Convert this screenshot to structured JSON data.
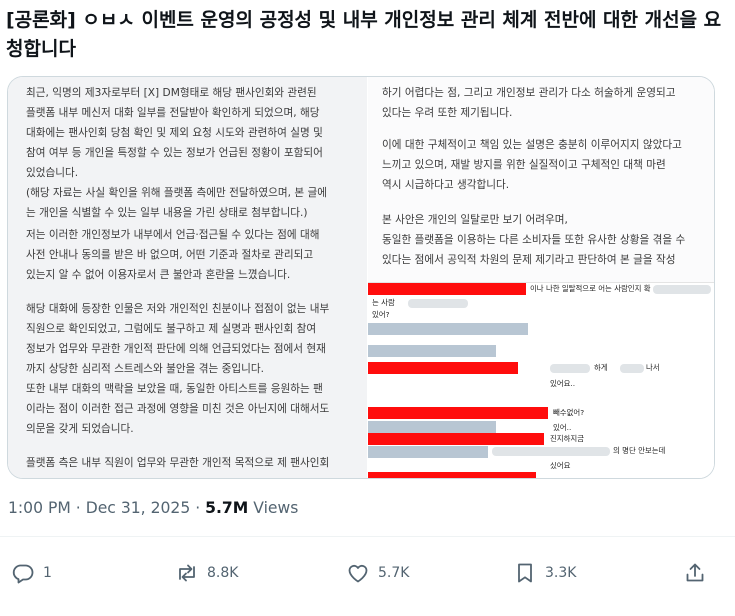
{
  "tweet": {
    "title": "[공론화] ㅇㅂㅅ 이벤트 운영의 공정성 및 내부 개인정보 관리 체계 전반에 대한 개선을 요청합니다",
    "time": "1:00 PM · Dec 31, 2025 · ",
    "views_count": "5.7M",
    "views_label": " Views"
  },
  "image": {
    "left_paragraphs": [
      "최근, 익명의 제3자로부터 [X] DM형태로 해당 팬사인회와 관련된\n플랫폼 내부 메신저 대화 일부를 전달받아 확인하게 되었으며, 해당\n대화에는 팬사인회 당첨 확인 및 제외 요청 시도와 관련하여 실명 및\n참여 여부 등 개인을 특정할 수 있는 정보가 언급된 정황이 포함되어\n있었습니다.\n(해당 자료는 사실 확인을 위해 플랫폼 측에만 전달하였으며, 본 글에\n는 개인을 식별할 수 있는 일부 내용을 가린 상태로 첨부합니다.)",
      "저는 이러한 개인정보가 내부에서 언급·접근될 수 있다는 점에 대해\n사전 안내나 동의를 받은 바 없으며, 어떤 기준과 절차로 관리되고\n있는지 알 수 없어 이용자로서 큰 불안과 혼란을 느꼈습니다.",
      "해당 대화에 등장한 인물은 저와 개인적인 친분이나 접점이 없는 내부\n직원으로 확인되었고, 그럼에도 불구하고 제 실명과 팬사인회 참여\n정보가 업무와 무관한 개인적 판단에 의해 언급되었다는 점에서 현재\n까지 상당한 심리적 스트레스와 불안을 겪는 중입니다.\n또한 내부 대화의 맥락을 보았을 때, 동일한 아티스트를 응원하는 팬\n이라는 점이 이러한 접근 과정에 영향을 미친 것은 아닌지에 대해서도\n의문을 갖게 되었습니다.",
      "플랫폼 측은 내부 직원이 업무와 무관한 개인적 목적으로 제 팬사인회"
    ],
    "right_paragraphs": [
      "하기 어렵다는 점, 그리고 개인정보 관리가 다소 허술하게 운영되고\n있다는 우려 또한 제기됩니다.",
      "이에 대한 구체적이고 책임 있는 설명은 충분히 이루어지지 않았다고\n느끼고 있으며, 재발 방지를 위한 실질적이고 구체적인 대책 마련\n역시 시급하다고 생각합니다.",
      "본 사안은 개인의 일탈로만 보기 어려우며,\n동일한 플랫폼을 이용하는 다른 소비자들 또한 유사한 상황을 겪을 수\n있다는 점에서 공익적 차원의 문제 제기라고 판단하여 본 글을 작성"
    ],
    "chat": [
      "이나 나한 일탈적으로 어는 사람인지 확",
      "는 사람",
      "있어?",
      "하게",
      "나서",
      "있어요..",
      "빼수없어?",
      "있어..",
      "진지하지금",
      "의 명단 안보는데",
      "싰어요"
    ]
  },
  "actions": {
    "replies": "1",
    "reposts": "8.8K",
    "likes": "5.7K",
    "bookmarks": "3.3K"
  },
  "colors": {
    "icon": "#536471",
    "redaction_red": "#ff0d0d",
    "redaction_blue": "#b8c6d3"
  },
  "icons": [
    "reply-icon",
    "repost-icon",
    "like-icon",
    "bookmark-icon",
    "share-icon"
  ]
}
